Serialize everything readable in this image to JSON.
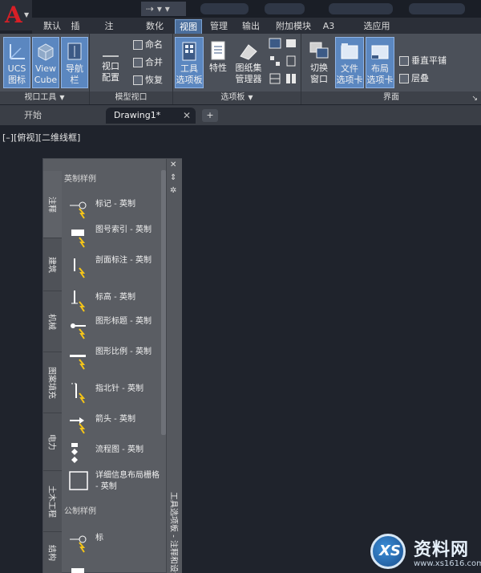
{
  "quick_access": {
    "redo_glyph": "⇢"
  },
  "ribbon_tabs": [
    {
      "label": "默认",
      "active": false
    },
    {
      "label": "插",
      "active": false
    },
    {
      "label": "注",
      "active": false
    },
    {
      "label": "数化",
      "active": false
    },
    {
      "label": "视图",
      "active": true
    },
    {
      "label": "管理",
      "active": false
    },
    {
      "label": "输出",
      "active": false
    },
    {
      "label": "附加模块",
      "active": false
    },
    {
      "label": "A3",
      "active": false
    },
    {
      "label": "选应用",
      "active": false
    }
  ],
  "ribbon": {
    "viewport_tools": {
      "title": "视口工具",
      "ucs": "UCS\n图标",
      "viewcube": "View\nCube",
      "navbar": "导航栏"
    },
    "model_viewports": {
      "title": "模型视口",
      "config": "视口\n配置",
      "name": "命名",
      "merge": "合并",
      "restore": "恢复"
    },
    "palettes": {
      "title": "选项板",
      "toolpalette": "工具\n选项板",
      "properties": "特性",
      "sheetset": "图纸集\n管理器"
    },
    "interface": {
      "title": "界面",
      "switch": "切换\n窗口",
      "filetabs": "文件\n选项卡",
      "layouttabs": "布局\n选项卡",
      "tile": "垂直平铺",
      "cascade": "层叠"
    }
  },
  "doc_tabs": [
    {
      "label": "开始",
      "active": false
    },
    {
      "label": "Drawing1*",
      "active": true
    }
  ],
  "view_label": "[–][俯视][二维线框]",
  "palette": {
    "side_tabs": [
      "注释",
      "建筑",
      "机械",
      "图案填充",
      "电力",
      "土木工程",
      "结构"
    ],
    "section1": "英制样例",
    "items": [
      "标记 - 英制",
      "图号索引 - 英制",
      "剖面标注 - 英制",
      "标高 - 英制",
      "图形标题 - 英制",
      "图形比例 - 英制",
      "指北针 - 英制",
      "箭头 - 英制",
      "流程图 - 英制",
      "详细信息布局栅格 - 英制"
    ],
    "section2": "公制样例",
    "item_partial": "标",
    "vertical_title": "工具选项板 - 注释和设计"
  },
  "watermark": {
    "title": "资料网",
    "url": "www.xs1616.com"
  },
  "colors": {
    "accent": "#4a6e9c",
    "canvas": "#1f232c",
    "brand_red": "#d81f26"
  }
}
